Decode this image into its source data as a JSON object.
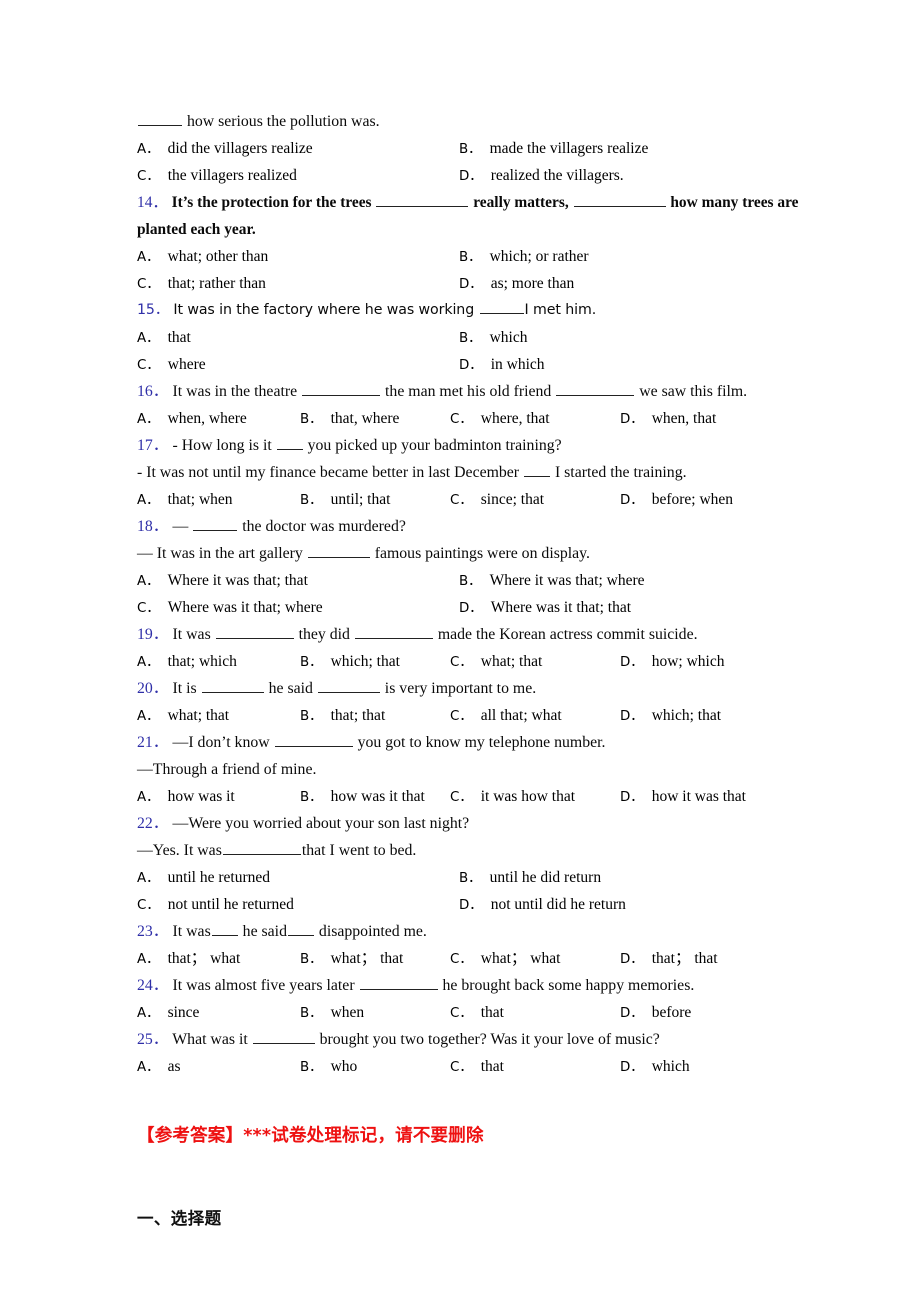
{
  "document": {
    "type": "english-grammar-worksheet",
    "colors": {
      "question_number": "#2f2fa8",
      "body_text": "#0a0a0a",
      "answer_key_red": "#ee1111",
      "page_background": "#ffffff"
    }
  },
  "carryover": {
    "stem_tail": "____ how serious the pollution was.",
    "options": [
      {
        "letter": "A．",
        "text": "did the villagers realize"
      },
      {
        "letter": "B．",
        "text": "made the villagers realize"
      },
      {
        "letter": "C．",
        "text": "the villagers realized"
      },
      {
        "letter": "D．",
        "text": "realized the villagers."
      }
    ]
  },
  "questions": [
    {
      "number": "14．",
      "style": "serif-bold",
      "stem_parts": [
        "It’s the protection for the trees ",
        "BLANK_XL",
        " really matters, ",
        "BLANK_XL",
        " how many trees are planted each year."
      ],
      "stem_plain": "It’s the protection for the trees __________ really matters, ___________ how many trees are planted each year.",
      "layout": "cols2",
      "options": [
        {
          "letter": "A．",
          "text": "what; other than"
        },
        {
          "letter": "B．",
          "text": "which; or rather"
        },
        {
          "letter": "C．",
          "text": "that; rather than"
        },
        {
          "letter": "D．",
          "text": "as; more than"
        }
      ]
    },
    {
      "number": "15．",
      "style": "sans",
      "stem_parts": [
        "It was in the factory where he was working ",
        "BLANK_SM",
        "I met him."
      ],
      "stem_plain": "It was in the factory where he was working ____I met him.",
      "layout": "cols2",
      "options": [
        {
          "letter": "A．",
          "text": "that"
        },
        {
          "letter": "B．",
          "text": "which"
        },
        {
          "letter": "C．",
          "text": "where"
        },
        {
          "letter": "D．",
          "text": "in which"
        }
      ]
    },
    {
      "number": "16．",
      "style": "serif",
      "stem_parts": [
        "It was in the theatre ",
        "BLANK_LG",
        " the man met his old friend ",
        "BLANK_LG",
        " we saw this film."
      ],
      "stem_plain": "It was in the theatre ________ the man met his old friend ________ we saw this film.",
      "layout": "cols4",
      "options": [
        {
          "letter": "A．",
          "text": "when, where"
        },
        {
          "letter": "B．",
          "text": "that, where"
        },
        {
          "letter": "C．",
          "text": "where, that"
        },
        {
          "letter": "D．",
          "text": "when, that"
        }
      ]
    },
    {
      "number": "17．",
      "style": "serif",
      "stem_parts": [
        "- How long is it ",
        "BLANK_XS",
        " you picked up your badminton training?"
      ],
      "stem_plain": "- How long is it __ you picked up your badminton training?",
      "extra_line": "- It was not until my finance became better in last December __ I started the training.",
      "extra_line_parts": [
        "- It was not until my finance became better in last December ",
        "BLANK_XS",
        " I started the training."
      ],
      "layout": "cols4",
      "options": [
        {
          "letter": "A．",
          "text": "that; when"
        },
        {
          "letter": "B．",
          "text": "until; that"
        },
        {
          "letter": "C．",
          "text": "since; that"
        },
        {
          "letter": "D．",
          "text": "before; when"
        }
      ]
    },
    {
      "number": "18．",
      "style": "serif",
      "stem_parts": [
        "— ",
        "BLANK_SM",
        " the doctor was murdered?"
      ],
      "stem_plain": "— ____ the doctor was murdered?",
      "extra_line": "— It was in the art gallery _____ famous paintings were on display.",
      "extra_line_parts": [
        "— It was in the art gallery ",
        "BLANK_MD",
        " famous paintings were on display."
      ],
      "layout": "cols2",
      "options": [
        {
          "letter": "A．",
          "text": "Where it was that; that"
        },
        {
          "letter": "B．",
          "text": "Where it was that; where"
        },
        {
          "letter": "C．",
          "text": "Where was it that; where"
        },
        {
          "letter": "D．",
          "text": "Where was it that; that"
        }
      ]
    },
    {
      "number": "19．",
      "style": "serif",
      "stem_parts": [
        "It was ",
        "BLANK_LG",
        " they did ",
        "BLANK_LG",
        " made the Korean actress commit suicide."
      ],
      "stem_plain": "It was ________ they did ________ made the Korean actress commit suicide.",
      "layout": "cols4",
      "options": [
        {
          "letter": "A．",
          "text": "that; which"
        },
        {
          "letter": "B．",
          "text": "which; that"
        },
        {
          "letter": "C．",
          "text": "what; that"
        },
        {
          "letter": "D．",
          "text": "how; which"
        }
      ]
    },
    {
      "number": "20．",
      "style": "serif",
      "stem_parts": [
        "It is ",
        "BLANK_MD",
        " he said ",
        "BLANK_MD",
        " is very important to me."
      ],
      "stem_plain": "It is _______ he said _______ is very important to me.",
      "layout": "cols4",
      "options": [
        {
          "letter": "A．",
          "text": "what; that"
        },
        {
          "letter": "B．",
          "text": "that; that"
        },
        {
          "letter": "C．",
          "text": "all that; what"
        },
        {
          "letter": "D．",
          "text": "which; that"
        }
      ]
    },
    {
      "number": "21．",
      "style": "serif",
      "stem_parts": [
        "—I don’t know ",
        "BLANK_LG",
        " you got to know my telephone number."
      ],
      "stem_plain": "—I don’t know ________ you got to know my telephone number.",
      "extra_line": "—Through a friend of mine.",
      "layout": "cols4",
      "options": [
        {
          "letter": "A．",
          "text": "how was it"
        },
        {
          "letter": "B．",
          "text": "how was it that"
        },
        {
          "letter": "C．",
          "text": "it was how that"
        },
        {
          "letter": "D．",
          "text": "how it was that"
        }
      ]
    },
    {
      "number": "22．",
      "style": "serif",
      "stem_parts": [
        "—Were you worried about your son last night?"
      ],
      "stem_plain": "—Were you worried about your son last night?",
      "extra_line": "—Yes. It was________that I went to bed.",
      "extra_line_parts": [
        "—Yes. It was",
        "BLANK_LG",
        "that I went to bed."
      ],
      "layout": "cols2",
      "options": [
        {
          "letter": "A．",
          "text": "until he returned"
        },
        {
          "letter": "B．",
          "text": "until he did return"
        },
        {
          "letter": "C．",
          "text": "not until he returned"
        },
        {
          "letter": "D．",
          "text": "not until did he return"
        }
      ]
    },
    {
      "number": "23．",
      "style": "serif",
      "stem_parts": [
        "It was",
        "BLANK_XS",
        " he said",
        "BLANK_XS",
        " disappointed me."
      ],
      "stem_plain": "It was__ he said__ disappointed me.",
      "layout": "cols4",
      "options": [
        {
          "letter": "A．",
          "text": "that； what"
        },
        {
          "letter": "B．",
          "text": "what； that"
        },
        {
          "letter": "C．",
          "text": "what； what"
        },
        {
          "letter": "D．",
          "text": "that； that"
        }
      ]
    },
    {
      "number": "24．",
      "style": "serif",
      "stem_parts": [
        "It was almost five years later ",
        "BLANK_LG",
        " he brought back some happy memories."
      ],
      "stem_plain": "It was almost five years later _______ he brought back some happy memories.",
      "layout": "cols4",
      "options": [
        {
          "letter": "A．",
          "text": "since"
        },
        {
          "letter": "B．",
          "text": "when"
        },
        {
          "letter": "C．",
          "text": "that"
        },
        {
          "letter": "D．",
          "text": "before"
        }
      ]
    },
    {
      "number": "25．",
      "style": "serif",
      "stem_parts": [
        "What was it ",
        "BLANK_MD",
        " brought you two together? Was it your love of music?"
      ],
      "stem_plain": "What was it ______ brought you two together? Was it your love of music?",
      "layout": "cols4",
      "options": [
        {
          "letter": "A．",
          "text": "as"
        },
        {
          "letter": "B．",
          "text": "who"
        },
        {
          "letter": "C．",
          "text": "that"
        },
        {
          "letter": "D．",
          "text": "which"
        }
      ]
    }
  ],
  "answer_key_banner": "【参考答案】***试卷处理标记，请不要删除",
  "section_heading": "一、选择题"
}
